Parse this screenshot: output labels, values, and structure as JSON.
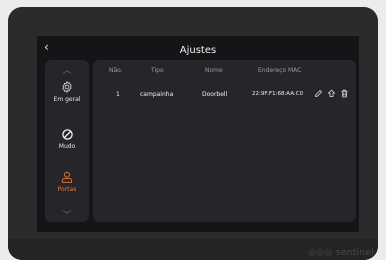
{
  "header": {
    "back_icon": "chevron-left-icon",
    "title": "Ajustes"
  },
  "sidebar": {
    "items": [
      {
        "label": "Em geral",
        "icon": "gear-icon",
        "active": false
      },
      {
        "label": "Mudo",
        "icon": "mute-icon",
        "active": false
      },
      {
        "label": "Portas",
        "icon": "door-person-icon",
        "active": true
      }
    ]
  },
  "table": {
    "columns": [
      "Não.",
      "Tipo",
      "Nome",
      "Endereço MAC"
    ],
    "rows": [
      {
        "no": "1",
        "type": "campainha",
        "name": "Doorbell",
        "mac": "22:9F:F1:68:AA:C0"
      }
    ]
  },
  "brand": {
    "logo_text": "sentinel",
    "accent": "#f07a3a"
  }
}
